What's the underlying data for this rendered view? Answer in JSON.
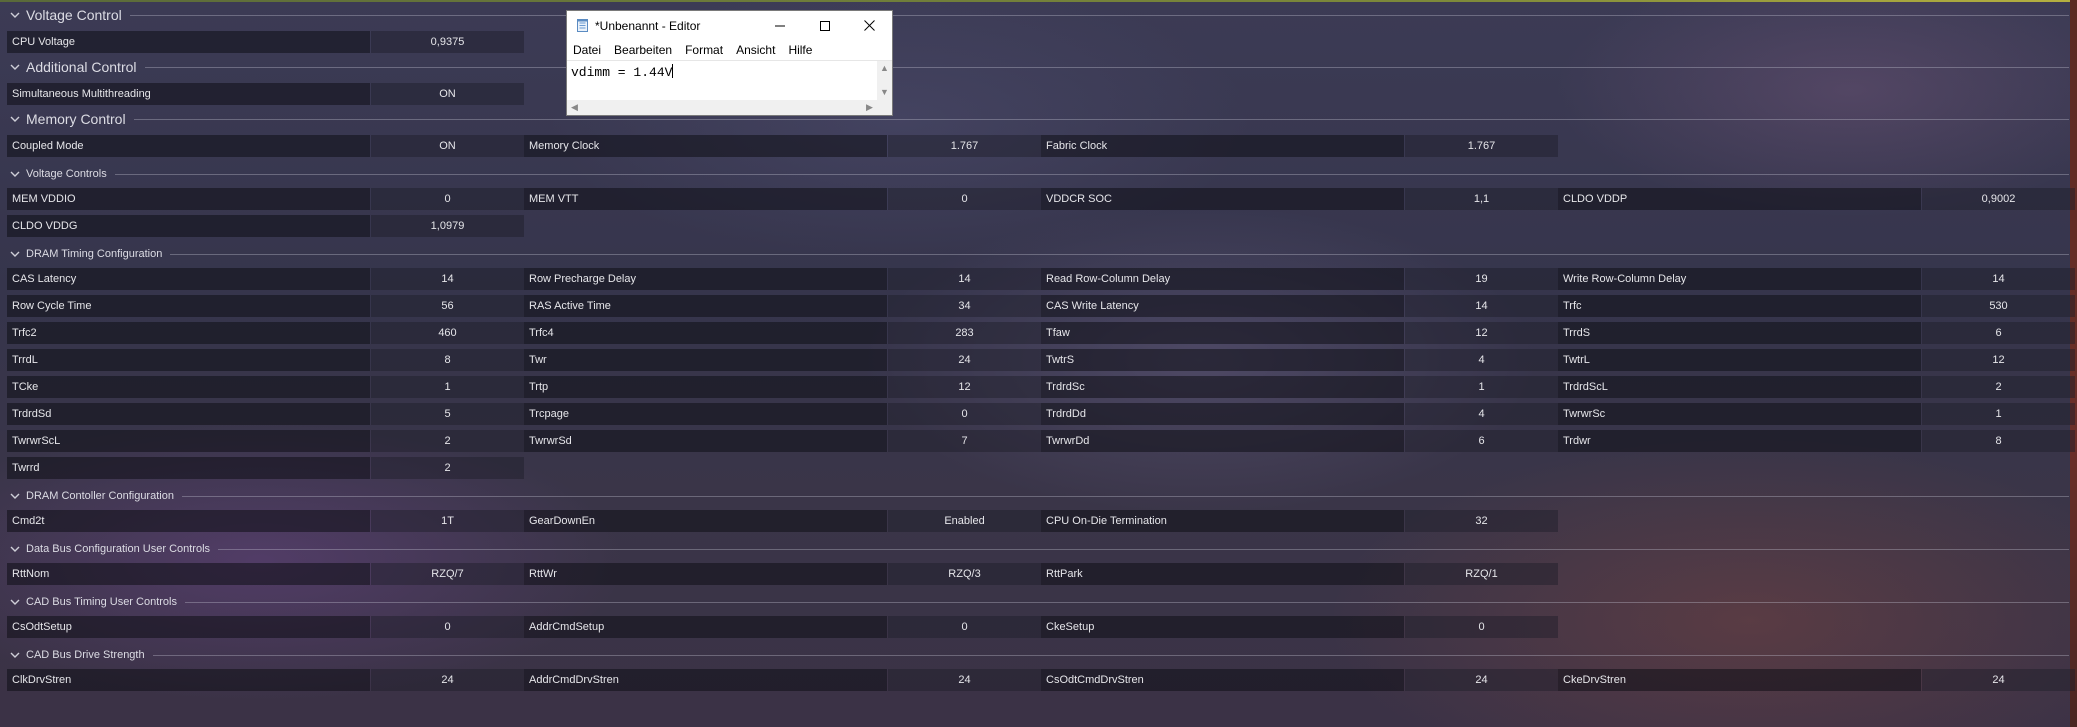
{
  "colors": {
    "background": "#3a384f",
    "cell_name_bg": "#0e0e16",
    "text": "#e6e6ea",
    "notepad_bg": "#ffffff"
  },
  "sections": [
    {
      "id": "voltage-control",
      "label": "Voltage Control",
      "size": "big",
      "collapsed": false,
      "rows": [
        [
          {
            "name": "CPU Voltage",
            "value": "0,9375"
          }
        ]
      ]
    },
    {
      "id": "additional-control",
      "label": "Additional Control",
      "size": "big",
      "collapsed": false,
      "rows": [
        [
          {
            "name": "Simultaneous Multithreading",
            "value": "ON"
          }
        ]
      ]
    },
    {
      "id": "memory-control",
      "label": "Memory Control",
      "size": "big",
      "collapsed": false,
      "rows": [
        [
          {
            "name": "Coupled Mode",
            "value": "ON"
          },
          {
            "name": "Memory Clock",
            "value": "1.767"
          },
          {
            "name": "Fabric Clock",
            "value": "1.767"
          }
        ]
      ]
    },
    {
      "id": "voltage-controls",
      "label": "Voltage Controls",
      "size": "small",
      "collapsed": false,
      "rows": [
        [
          {
            "name": "MEM VDDIO",
            "value": "0"
          },
          {
            "name": "MEM VTT",
            "value": "0"
          },
          {
            "name": "VDDCR SOC",
            "value": "1,1"
          },
          {
            "name": "CLDO VDDP",
            "value": "0,9002"
          }
        ],
        [
          {
            "name": "CLDO VDDG",
            "value": "1,0979"
          }
        ]
      ]
    },
    {
      "id": "dram-timing-configuration",
      "label": "DRAM Timing Configuration",
      "size": "small",
      "collapsed": false,
      "rows": [
        [
          {
            "name": "CAS Latency",
            "value": "14"
          },
          {
            "name": "Row Precharge Delay",
            "value": "14"
          },
          {
            "name": "Read Row-Column Delay",
            "value": "19"
          },
          {
            "name": "Write Row-Column Delay",
            "value": "14"
          }
        ],
        [
          {
            "name": "Row Cycle Time",
            "value": "56"
          },
          {
            "name": "RAS Active Time",
            "value": "34"
          },
          {
            "name": "CAS Write Latency",
            "value": "14"
          },
          {
            "name": "Trfc",
            "value": "530"
          }
        ],
        [
          {
            "name": "Trfc2",
            "value": "460"
          },
          {
            "name": "Trfc4",
            "value": "283"
          },
          {
            "name": "Tfaw",
            "value": "12"
          },
          {
            "name": "TrrdS",
            "value": "6"
          }
        ],
        [
          {
            "name": "TrrdL",
            "value": "8"
          },
          {
            "name": "Twr",
            "value": "24"
          },
          {
            "name": "TwtrS",
            "value": "4"
          },
          {
            "name": "TwtrL",
            "value": "12"
          }
        ],
        [
          {
            "name": "TCke",
            "value": "1"
          },
          {
            "name": "Trtp",
            "value": "12"
          },
          {
            "name": "TrdrdSc",
            "value": "1"
          },
          {
            "name": "TrdrdScL",
            "value": "2"
          }
        ],
        [
          {
            "name": "TrdrdSd",
            "value": "5"
          },
          {
            "name": "Trcpage",
            "value": "0"
          },
          {
            "name": "TrdrdDd",
            "value": "4"
          },
          {
            "name": "TwrwrSc",
            "value": "1"
          }
        ],
        [
          {
            "name": "TwrwrScL",
            "value": "2"
          },
          {
            "name": "TwrwrSd",
            "value": "7"
          },
          {
            "name": "TwrwrDd",
            "value": "6"
          },
          {
            "name": "Trdwr",
            "value": "8"
          }
        ],
        [
          {
            "name": "Twrrd",
            "value": "2"
          }
        ]
      ]
    },
    {
      "id": "dram-controller-configuration",
      "label": "DRAM Contoller Configuration",
      "size": "small",
      "collapsed": false,
      "rows": [
        [
          {
            "name": "Cmd2t",
            "value": "1T"
          },
          {
            "name": "GearDownEn",
            "value": "Enabled"
          },
          {
            "name": "CPU On-Die Termination",
            "value": "32"
          }
        ]
      ]
    },
    {
      "id": "data-bus-configuration",
      "label": "Data Bus Configuration User Controls",
      "size": "small",
      "collapsed": false,
      "rows": [
        [
          {
            "name": "RttNom",
            "value": "RZQ/7"
          },
          {
            "name": "RttWr",
            "value": "RZQ/3"
          },
          {
            "name": "RttPark",
            "value": "RZQ/1"
          }
        ]
      ]
    },
    {
      "id": "cad-bus-timing",
      "label": "CAD Bus Timing User Controls",
      "size": "small",
      "collapsed": false,
      "rows": [
        [
          {
            "name": "CsOdtSetup",
            "value": "0"
          },
          {
            "name": "AddrCmdSetup",
            "value": "0"
          },
          {
            "name": "CkeSetup",
            "value": "0"
          }
        ]
      ]
    },
    {
      "id": "cad-bus-drive-strength",
      "label": "CAD Bus Drive Strength",
      "size": "small",
      "collapsed": false,
      "rows": [
        [
          {
            "name": "ClkDrvStren",
            "value": "24"
          },
          {
            "name": "AddrCmdDrvStren",
            "value": "24"
          },
          {
            "name": "CsOdtCmdDrvStren",
            "value": "24"
          },
          {
            "name": "CkeDrvStren",
            "value": "24"
          }
        ]
      ]
    }
  ],
  "notepad": {
    "title": "*Unbenannt - Editor",
    "menu": [
      "Datei",
      "Bearbeiten",
      "Format",
      "Ansicht",
      "Hilfe"
    ],
    "content": "vdimm = 1.44V",
    "icons": {
      "app": "notepad-icon",
      "minimize": "minimize-icon",
      "maximize": "maximize-icon",
      "close": "close-icon"
    }
  }
}
